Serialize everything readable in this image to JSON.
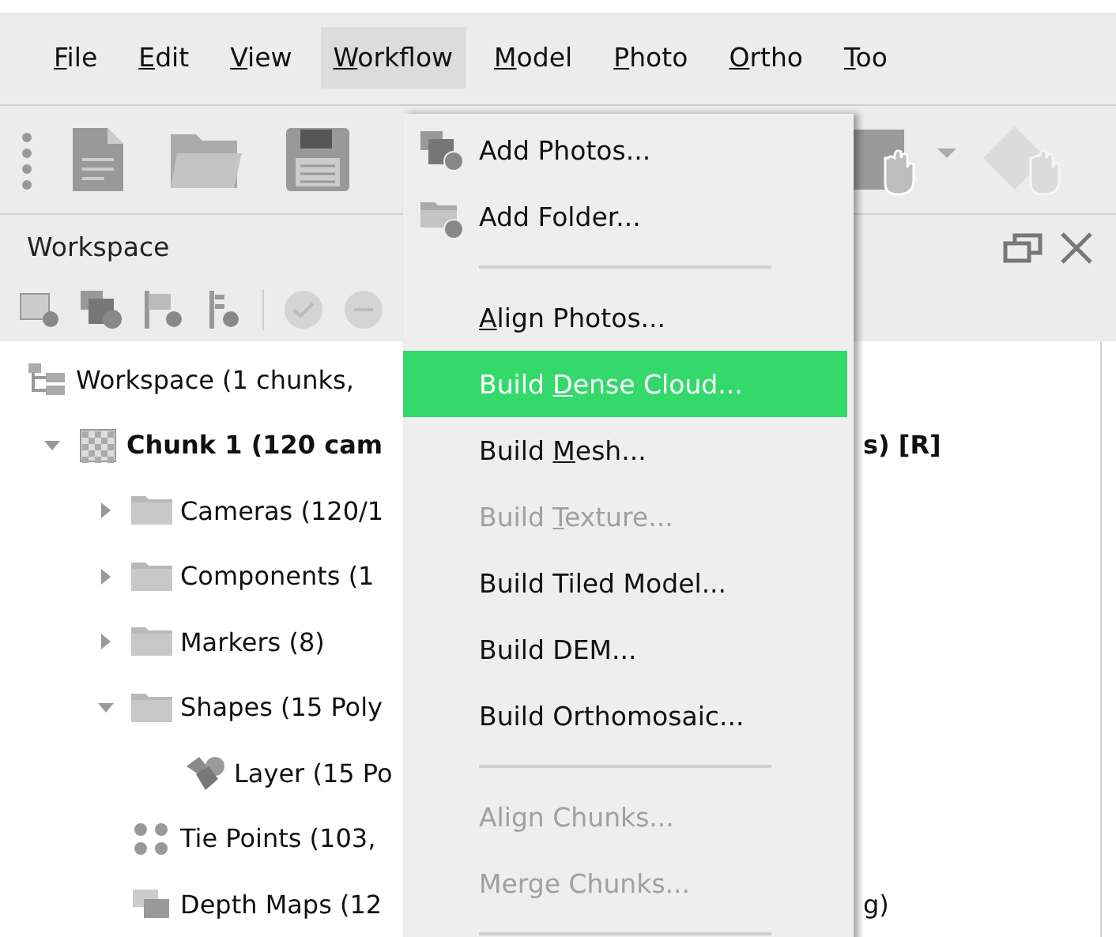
{
  "menubar": [
    {
      "mnemonic": "F",
      "after": "ile",
      "selected": false
    },
    {
      "mnemonic": "E",
      "after": "dit",
      "selected": false
    },
    {
      "mnemonic": "V",
      "after": "iew",
      "selected": false
    },
    {
      "mnemonic": "W",
      "after": "orkflow",
      "selected": true
    },
    {
      "mnemonic": "M",
      "after": "odel",
      "selected": false
    },
    {
      "mnemonic": "P",
      "after": "hoto",
      "selected": false
    },
    {
      "mnemonic": "O",
      "after": "rtho",
      "selected": false
    },
    {
      "mnemonic": "T",
      "after": "oo",
      "selected": false
    }
  ],
  "panel": {
    "title": "Workspace"
  },
  "tree": [
    {
      "kind": "workspace",
      "text": "Workspace (1 chunks, ",
      "children": [
        {
          "kind": "chunk",
          "text": "Chunk 1 (120 cam",
          "text_right": "s) [R]",
          "active": true,
          "expanded": true,
          "children": [
            {
              "kind": "folder",
              "text": "Cameras (120/1",
              "expanded": false
            },
            {
              "kind": "folder",
              "text": "Components (1",
              "expanded": false
            },
            {
              "kind": "folder",
              "text": "Markers (8)",
              "expanded": false
            },
            {
              "kind": "folder",
              "text": "Shapes (15 Poly",
              "expanded": true,
              "children": [
                {
                  "kind": "shape-layer",
                  "text": "Layer (15 Po"
                }
              ]
            },
            {
              "kind": "tie-points",
              "text": "Tie Points (103,"
            },
            {
              "kind": "depth-maps",
              "text": "Depth Maps (12",
              "text_right": "g)"
            }
          ]
        }
      ]
    }
  ],
  "menu": [
    {
      "kind": "photos-item",
      "label": "Add Photos...",
      "disabled": false,
      "selected": false
    },
    {
      "kind": "folder-item",
      "label": "Add Folder...",
      "disabled": false,
      "selected": false
    },
    {
      "kind": "separator"
    },
    {
      "kind": "item",
      "mnemonic": "A",
      "after": "lign Photos...",
      "disabled": false,
      "selected": false
    },
    {
      "kind": "item",
      "before": "Build ",
      "mnemonic": "D",
      "after": "ense Cloud...",
      "disabled": false,
      "selected": true
    },
    {
      "kind": "item",
      "before": "Build ",
      "mnemonic": "M",
      "after": "esh...",
      "disabled": false,
      "selected": false
    },
    {
      "kind": "item",
      "before": "Build ",
      "mnemonic": "T",
      "after": "exture...",
      "disabled": true,
      "selected": false
    },
    {
      "kind": "item",
      "label": "Build Tiled Model...",
      "disabled": false,
      "selected": false
    },
    {
      "kind": "item",
      "label": "Build DEM...",
      "disabled": false,
      "selected": false
    },
    {
      "kind": "item",
      "label": "Build Orthomosaic...",
      "disabled": false,
      "selected": false
    },
    {
      "kind": "separator"
    },
    {
      "kind": "item",
      "label": "Align Chunks...",
      "disabled": true,
      "selected": false
    },
    {
      "kind": "item",
      "label": "Merge Chunks...",
      "disabled": true,
      "selected": false
    },
    {
      "kind": "separator"
    }
  ]
}
